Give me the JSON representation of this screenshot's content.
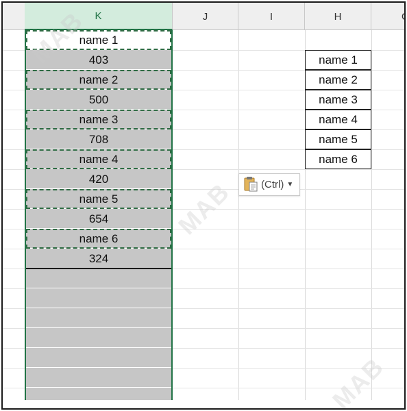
{
  "columns": [
    {
      "key": "K",
      "label": "K",
      "selected": true
    },
    {
      "key": "J",
      "label": "J",
      "selected": false
    },
    {
      "key": "I",
      "label": "I",
      "selected": false
    },
    {
      "key": "H",
      "label": "H",
      "selected": false
    },
    {
      "key": "G",
      "label": "G",
      "selected": false
    }
  ],
  "column_k_cells": [
    "name 1",
    "403",
    "name 2",
    "500",
    "name 3",
    "708",
    "name 4",
    "420",
    "name 5",
    "654",
    "name 6",
    "324"
  ],
  "column_h_cells": [
    "name 1",
    "name 2",
    "name 3",
    "name 4",
    "name 5",
    "name 6"
  ],
  "paste_options": {
    "label": "(Ctrl)",
    "icon": "clipboard-icon"
  },
  "watermark": {
    "text": "MAB"
  },
  "colors": {
    "selection_border": "#217346",
    "selected_fill": "#c6c6c6",
    "header_selected": "#d3ecdd"
  }
}
